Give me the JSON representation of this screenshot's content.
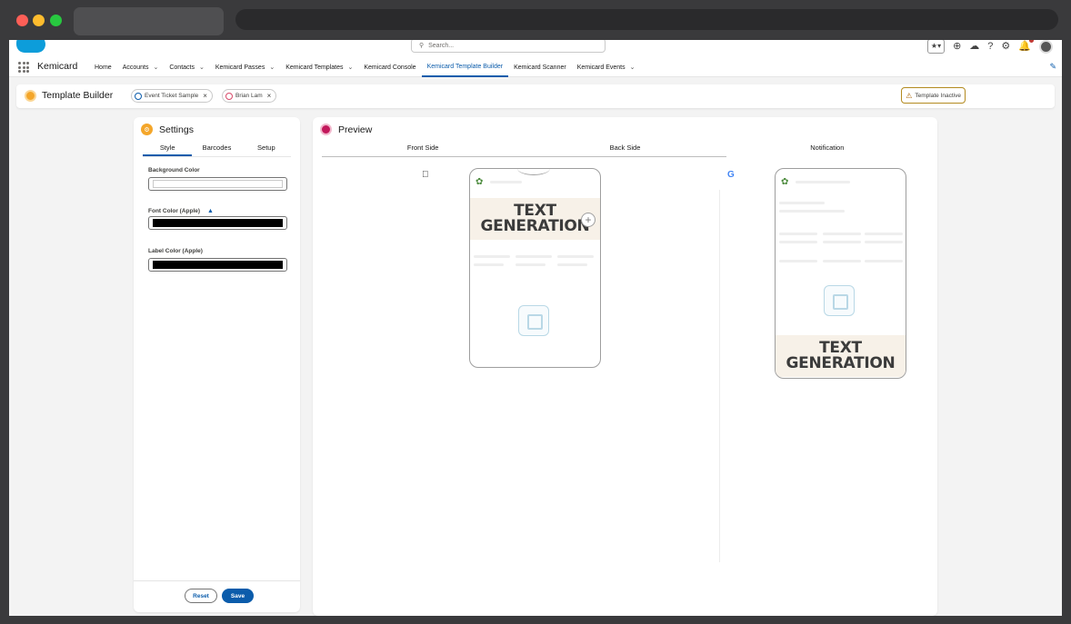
{
  "global_header": {
    "search_placeholder": "Search..."
  },
  "nav": {
    "app_name": "Kemicard",
    "items": [
      {
        "label": "Home",
        "has_menu": false,
        "active": false
      },
      {
        "label": "Accounts",
        "has_menu": true,
        "active": false
      },
      {
        "label": "Contacts",
        "has_menu": true,
        "active": false
      },
      {
        "label": "Kemicard Passes",
        "has_menu": true,
        "active": false
      },
      {
        "label": "Kemicard Templates",
        "has_menu": true,
        "active": false
      },
      {
        "label": "Kemicard Console",
        "has_menu": false,
        "active": false
      },
      {
        "label": "Kemicard Template Builder",
        "has_menu": false,
        "active": true
      },
      {
        "label": "Kemicard Scanner",
        "has_menu": false,
        "active": false
      },
      {
        "label": "Kemicard Events",
        "has_menu": true,
        "active": false
      }
    ]
  },
  "page_header": {
    "title": "Template Builder",
    "pills": [
      "Event Ticket Sample",
      "Brian Lam"
    ],
    "status_badge": "Template Inactive"
  },
  "settings": {
    "title": "Settings",
    "tabs": [
      "Style",
      "Barcodes",
      "Setup"
    ],
    "active_tab": "Style",
    "fields": [
      {
        "label": "Background Color",
        "color": "#ffffff"
      },
      {
        "label": "Font Color (Apple)",
        "color": "#000000"
      },
      {
        "label": "Label Color (Apple)",
        "color": "#000000"
      }
    ],
    "reset_label": "Reset",
    "save_label": "Save"
  },
  "preview": {
    "title": "Preview",
    "tabs": [
      "Front Side",
      "Back Side",
      "Notification"
    ],
    "apple_text": "TEXT\nGENERATION",
    "google_text": "TEXT\nGENERATION"
  },
  "colors": {
    "accent": "#0b5cab",
    "settings_icon": "#f4a62a",
    "preview_icon": "#c2185b"
  }
}
